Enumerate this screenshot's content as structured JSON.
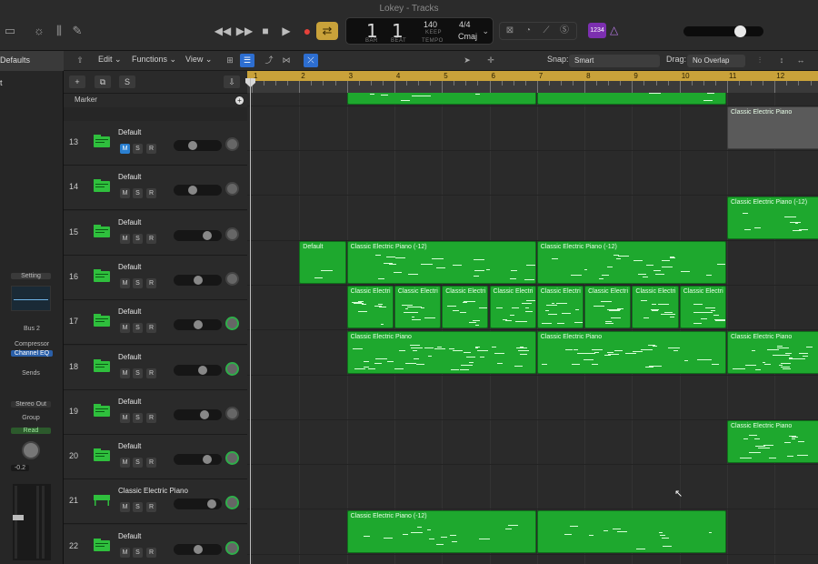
{
  "window": {
    "title": "Lokey - Tracks"
  },
  "transport": {
    "bar": "1",
    "beat": "1",
    "bar_label": "BAR",
    "beat_label": "BEAT",
    "tempo": "140",
    "tempo_mode": "KEEP",
    "tempo_label": "TEMPO",
    "time_signature": "4/4",
    "key": "Cmaj",
    "count_in": "1234",
    "master_volume": 0.7
  },
  "inspector": {
    "header": "Defaults",
    "setting": "Setting",
    "bus": "Bus 2",
    "plugins": [
      "Compressor",
      "Channel EQ"
    ],
    "sends": "Sends",
    "output": "Stereo Out",
    "group": "Group",
    "automation": "Read",
    "volume_value": "-0.2"
  },
  "toolbar": {
    "edit": "Edit",
    "functions": "Functions",
    "view": "View",
    "snap_label": "Snap:",
    "snap_value": "Smart",
    "drag_label": "Drag:",
    "drag_value": "No Overlap"
  },
  "track_list": {
    "marker_label": "Marker"
  },
  "ruler": {
    "bars": [
      "1",
      "2",
      "3",
      "4",
      "5",
      "6",
      "7",
      "8",
      "9",
      "10",
      "11",
      "12"
    ]
  },
  "tracks": [
    {
      "number": "13",
      "name": "Default",
      "mute_on": true,
      "volume": 0.4,
      "pan_green": false
    },
    {
      "number": "14",
      "name": "Default",
      "mute_on": false,
      "volume": 0.4,
      "pan_green": false
    },
    {
      "number": "15",
      "name": "Default",
      "mute_on": false,
      "volume": 0.7,
      "pan_green": false
    },
    {
      "number": "16",
      "name": "Default",
      "mute_on": false,
      "volume": 0.5,
      "pan_green": false
    },
    {
      "number": "17",
      "name": "Default",
      "mute_on": false,
      "volume": 0.5,
      "pan_green": true
    },
    {
      "number": "18",
      "name": "Default",
      "mute_on": false,
      "volume": 0.6,
      "pan_green": true
    },
    {
      "number": "19",
      "name": "Default",
      "mute_on": false,
      "volume": 0.65,
      "pan_green": false
    },
    {
      "number": "20",
      "name": "Default",
      "mute_on": false,
      "volume": 0.7,
      "pan_green": true
    },
    {
      "number": "21",
      "name": "Classic Electric Piano",
      "mute_on": false,
      "volume": 0.8,
      "pan_green": true
    },
    {
      "number": "22",
      "name": "Default",
      "mute_on": false,
      "volume": 0.5,
      "pan_green": true
    }
  ],
  "regions": {
    "r12_top": "",
    "r13": "Classic Electric Piano",
    "r15": "Classic Electric Piano (-12)",
    "r16_default": "Default",
    "r16_a": "Classic Electric Piano (-12)",
    "r16_b": "Classic Electric Piano (-12)",
    "r17": [
      "Classic Electri",
      "Classic Electri",
      "Classic Electri",
      "Classic Electri",
      "Classic Electri",
      "Classic Electri",
      "Classic Electri",
      "Classic Electri"
    ],
    "r18_a": "Classic Electric Piano",
    "r18_b": "Classic Electric Piano",
    "r20": "Classic Electric Piano",
    "r22": "Classic Electric Piano (-12)"
  },
  "icons": {
    "play": "play-icon",
    "stop": "stop-icon",
    "record": "record-icon",
    "rewind": "rewind-icon",
    "forward": "fast-forward-icon",
    "cycle": "cycle-icon"
  }
}
